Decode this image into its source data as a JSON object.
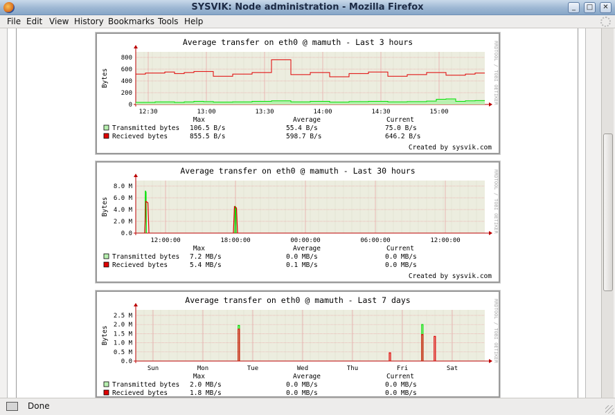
{
  "window": {
    "title": "SYSVIK: Node administration - Mozilla Firefox"
  },
  "menu": [
    "File",
    "Edit",
    "View",
    "History",
    "Bookmarks",
    "Tools",
    "Help"
  ],
  "status": {
    "text": "Done"
  },
  "colors": {
    "transmitted": "#00e000",
    "received": "#e00000",
    "grid": "#eceddf",
    "gridline": "#e9a3a3"
  },
  "graphs": [
    {
      "title": "Average transfer on eth0 @ mamuth - Last 3 hours",
      "ylabel": "Bytes",
      "side_text": "RRDTOOL / TOBI OETIKER",
      "yticks": [
        "800",
        "600",
        "400",
        "200",
        "0"
      ],
      "xticks": [
        "12:30",
        "13:00",
        "13:30",
        "14:00",
        "14:30",
        "15:00"
      ],
      "header": {
        "max": "Max",
        "avg": "Average",
        "cur": "Current"
      },
      "rows": [
        {
          "label": "Transmitted bytes",
          "max": "106.5  B/s",
          "avg": "55.4  B/s",
          "cur": "75.0  B/s"
        },
        {
          "label": "Recieved bytes",
          "max": "855.5  B/s",
          "avg": "598.7  B/s",
          "cur": "646.2  B/s"
        }
      ],
      "footer": "Created by sysvik.com"
    },
    {
      "title": "Average transfer on eth0 @ mamuth - Last 30 hours",
      "ylabel": "Bytes",
      "side_text": "RRDTOOL / TOBI OETIKER",
      "yticks": [
        "8.0 M",
        "6.0 M",
        "4.0 M",
        "2.0 M",
        "0.0"
      ],
      "xticks": [
        "12:00:00",
        "18:00:00",
        "00:00:00",
        "06:00:00",
        "12:00:00"
      ],
      "header": {
        "max": "Max",
        "avg": "Average",
        "cur": "Current"
      },
      "rows": [
        {
          "label": "Transmitted bytes",
          "max": "7.2 MB/s",
          "avg": "0.0 MB/s",
          "cur": "0.0 MB/s"
        },
        {
          "label": "Recieved bytes",
          "max": "5.4 MB/s",
          "avg": "0.1 MB/s",
          "cur": "0.0 MB/s"
        }
      ],
      "footer": "Created by sysvik.com"
    },
    {
      "title": "Average transfer on eth0 @ mamuth - Last 7 days",
      "ylabel": "Bytes",
      "side_text": "RRDTOOL / TOBI OETIKER",
      "yticks": [
        "2.5 M",
        "2.0 M",
        "1.5 M",
        "1.0 M",
        "0.5 M",
        "0.0"
      ],
      "xticks": [
        "Sun",
        "Mon",
        "Tue",
        "Wed",
        "Thu",
        "Fri",
        "Sat"
      ],
      "header": {
        "max": "Max",
        "avg": "Average",
        "cur": "Current"
      },
      "rows": [
        {
          "label": "Transmitted bytes",
          "max": "2.0 MB/s",
          "avg": "0.0 MB/s",
          "cur": "0.0 MB/s"
        },
        {
          "label": "Recieved bytes",
          "max": "1.8 MB/s",
          "avg": "0.0 MB/s",
          "cur": "0.0 MB/s"
        }
      ],
      "footer": ""
    }
  ],
  "chart_data": [
    {
      "type": "line",
      "title": "Average transfer on eth0 @ mamuth - Last 3 hours",
      "ylabel": "Bytes",
      "ylim": [
        0,
        900
      ],
      "x": [
        "12:20",
        "12:25",
        "12:30",
        "12:35",
        "12:40",
        "12:45",
        "12:50",
        "12:55",
        "13:00",
        "13:05",
        "13:10",
        "13:15",
        "13:20",
        "13:25",
        "13:30",
        "13:35",
        "13:40",
        "13:45",
        "13:50",
        "13:55",
        "14:00",
        "14:05",
        "14:10",
        "14:15",
        "14:20",
        "14:25",
        "14:30",
        "14:35",
        "14:40",
        "14:45",
        "14:50",
        "14:55",
        "15:00",
        "15:05",
        "15:10",
        "15:15"
      ],
      "series": [
        {
          "name": "Recieved bytes",
          "values": [
            580,
            600,
            600,
            620,
            590,
            610,
            630,
            630,
            540,
            540,
            580,
            580,
            610,
            610,
            855,
            855,
            570,
            570,
            610,
            610,
            530,
            530,
            590,
            590,
            620,
            620,
            540,
            540,
            570,
            570,
            610,
            610,
            560,
            560,
            580,
            600
          ]
        },
        {
          "name": "Transmitted bytes",
          "values": [
            40,
            40,
            50,
            50,
            40,
            50,
            60,
            55,
            45,
            45,
            50,
            50,
            60,
            60,
            70,
            70,
            50,
            50,
            60,
            60,
            45,
            45,
            55,
            55,
            60,
            60,
            50,
            50,
            55,
            55,
            65,
            100,
            106,
            60,
            70,
            75
          ]
        }
      ]
    },
    {
      "type": "line",
      "title": "Average transfer on eth0 @ mamuth - Last 30 hours",
      "ylabel": "Bytes",
      "ylim": [
        0,
        8.0
      ],
      "xticks": [
        "12:00:00",
        "18:00:00",
        "00:00:00",
        "06:00:00",
        "12:00:00"
      ],
      "series": [
        {
          "name": "Transmitted bytes",
          "spikes_at_hours": [
            10.3,
            18.0
          ],
          "peak_MB": [
            7.2,
            4.6
          ]
        },
        {
          "name": "Recieved bytes",
          "spikes_at_hours": [
            10.4,
            18.0
          ],
          "peak_MB": [
            5.4,
            4.5
          ]
        }
      ]
    },
    {
      "type": "line",
      "title": "Average transfer on eth0 @ mamuth - Last 7 days",
      "ylabel": "Bytes",
      "ylim": [
        0,
        2.5
      ],
      "xticks": [
        "Sun",
        "Mon",
        "Tue",
        "Wed",
        "Thu",
        "Fri",
        "Sat"
      ],
      "series": [
        {
          "name": "Transmitted bytes",
          "spikes": [
            {
              "day": 1.72,
              "peak_MB": 1.95
            },
            {
              "day": 5.4,
              "peak_MB": 2.0
            }
          ]
        },
        {
          "name": "Recieved bytes",
          "spikes": [
            {
              "day": 1.72,
              "peak_MB": 1.75
            },
            {
              "day": 4.75,
              "peak_MB": 0.45
            },
            {
              "day": 5.4,
              "peak_MB": 1.45
            },
            {
              "day": 5.65,
              "peak_MB": 1.35
            }
          ]
        }
      ]
    }
  ]
}
